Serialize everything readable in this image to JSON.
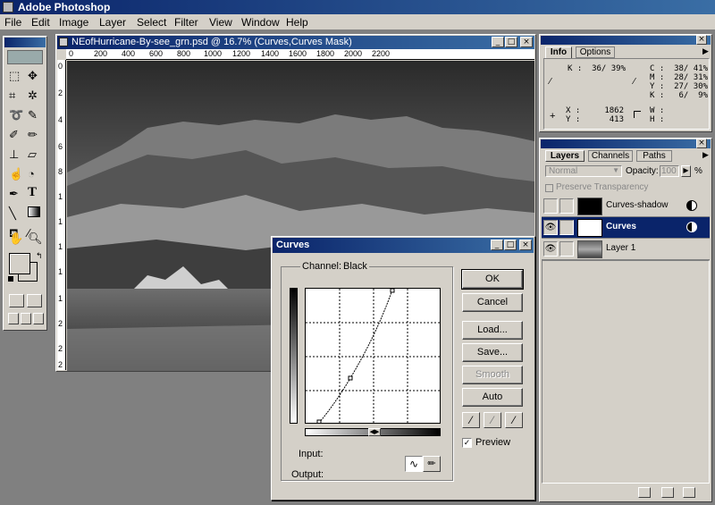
{
  "app": {
    "title": "Adobe Photoshop"
  },
  "menu": [
    "File",
    "Edit",
    "Image",
    "Layer",
    "Select",
    "Filter",
    "View",
    "Window",
    "Help"
  ],
  "document": {
    "title": "NEofHurricane-By-see_grn.psd @ 16.7% (Curves,Curves Mask)",
    "ruler_top": [
      "0",
      "200",
      "400",
      "600",
      "800",
      "1000",
      "1200",
      "1400",
      "1600",
      "1800",
      "2000",
      "2200"
    ],
    "ruler_left": [
      "0",
      "2",
      "4",
      "6",
      "8",
      "1",
      "1",
      "1",
      "1",
      "1",
      "2",
      "2",
      "2"
    ]
  },
  "info": {
    "tabs": [
      "Info",
      "Options"
    ],
    "k_left": "K :  36/ 39%",
    "c": "C :  38/ 41%",
    "m": "M :  28/ 31%",
    "y": "Y :  27/ 30%",
    "k": "K :   6/  9%",
    "x": "X :     1862",
    "yc": "Y :      413",
    "w": "W :",
    "h": "H :"
  },
  "layers": {
    "tabs": [
      "Layers",
      "Channels",
      "Paths"
    ],
    "blend_mode": "Normal",
    "opacity_label": "Opacity:",
    "opacity_value": "100",
    "percent": "%",
    "preserve": "Preserve Transparency",
    "items": [
      {
        "name": "Curves-shadow",
        "selected": false
      },
      {
        "name": "Curves",
        "selected": true
      },
      {
        "name": "Layer 1",
        "selected": false
      }
    ]
  },
  "curves": {
    "title": "Curves",
    "channel_label": "Channel:",
    "channel_value": "Black",
    "input_label": "Input:",
    "output_label": "Output:",
    "buttons": {
      "ok": "OK",
      "cancel": "Cancel",
      "load": "Load...",
      "save": "Save...",
      "smooth": "Smooth",
      "auto": "Auto"
    },
    "preview_label": "Preview",
    "preview_checked": true
  }
}
